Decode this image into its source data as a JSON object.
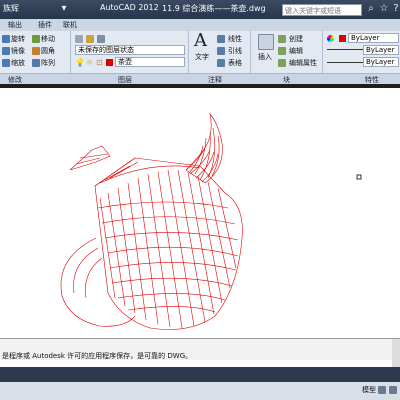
{
  "title_bar": {
    "partial_left": "族辉",
    "app": "AutoCAD 2012",
    "document": "11.9 综合演练——茶壶.dwg",
    "search_placeholder": "键入关键字或短语"
  },
  "menu": [
    "输出",
    "插件",
    "联机"
  ],
  "ribbon": {
    "modify": {
      "rotate": "旋转",
      "move": "移动",
      "mirror": "镜像",
      "fillet": "圆角",
      "array": "阵列",
      "scale": "缩放",
      "panel": "修改"
    },
    "layers": {
      "unsaved_state": "未保存的图层状态",
      "current_layer": "茶壶",
      "panel": "图层"
    },
    "annotation": {
      "text": "文字",
      "linear": "线性",
      "leader": "引线",
      "table": "表格",
      "panel": "注释"
    },
    "block": {
      "insert": "插入",
      "create": "创建",
      "edit": "编辑",
      "edit_attributes": "编辑属性",
      "panel": "块"
    },
    "properties": {
      "color": "ByLayer",
      "linetype": "ByLayer",
      "lineweight": "ByLayer",
      "panel": "特性"
    }
  },
  "command_line": "是程序或 Autodesk 许可的应用程序保存，是可靠的 DWG。",
  "status": {
    "model": "模型"
  },
  "colors": {
    "drawing_lines": "#e00000",
    "ribbon_bg": "#e3e9f2",
    "title_bg": "#2b3a50"
  }
}
